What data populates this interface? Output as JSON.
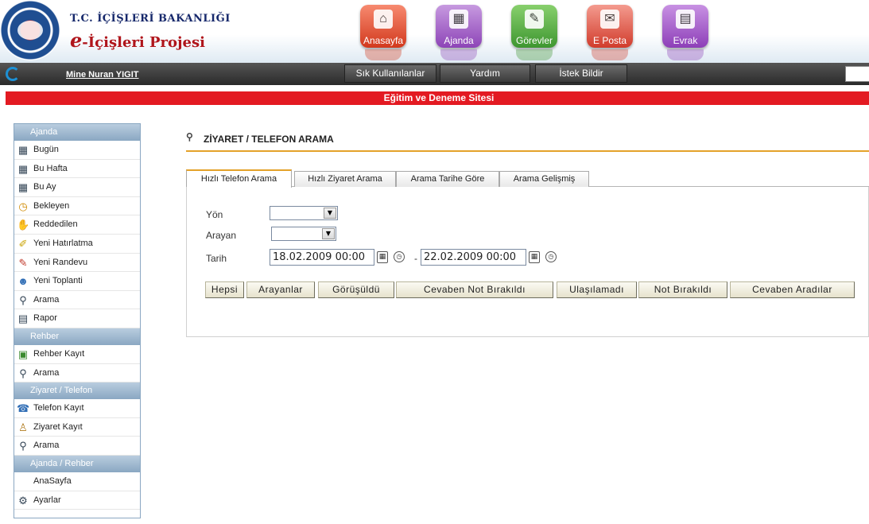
{
  "header": {
    "ministry": "T.C. İÇİŞLERİ BAKANLIĞI",
    "project_e": "e",
    "project_rest": "-İçişleri Projesi",
    "tiles": [
      {
        "label": "Anasayfa",
        "icon": "home-icon"
      },
      {
        "label": "Ajanda",
        "icon": "calendar-icon"
      },
      {
        "label": "Görevler",
        "icon": "tasks-icon"
      },
      {
        "label": "E Posta",
        "icon": "mail-icon"
      },
      {
        "label": "Evrak",
        "icon": "document-icon"
      }
    ]
  },
  "topbar": {
    "user": "Mine Nuran YIGIT",
    "buttons": [
      "Sık Kullanılanlar",
      "Yardım",
      "İstek Bildir"
    ]
  },
  "banner": "Eğitim ve Deneme Sitesi",
  "sidebar": {
    "sections": [
      {
        "title": "Ajanda",
        "items": [
          "Bugün",
          "Bu Hafta",
          "Bu Ay",
          "Bekleyen",
          "Reddedilen",
          "Yeni Hatırlatma",
          "Yeni Randevu",
          "Yeni Toplanti",
          "Arama",
          "Rapor"
        ]
      },
      {
        "title": "Rehber",
        "items": [
          "Rehber Kayıt",
          "Arama"
        ]
      },
      {
        "title": "Ziyaret / Telefon",
        "items": [
          "Telefon Kayıt",
          "Ziyaret Kayıt",
          "Arama"
        ]
      },
      {
        "title": "Ajanda / Rehber",
        "items": [
          "AnaSayfa",
          "Ayarlar"
        ]
      }
    ]
  },
  "main": {
    "title": "ZİYARET / TELEFON ARAMA",
    "tabs": [
      "Hızlı Telefon Arama",
      "Hızlı Ziyaret Arama",
      "Arama Tarihe Göre",
      "Arama Gelişmiş"
    ],
    "form": {
      "yon_label": "Yön",
      "arayan_label": "Arayan",
      "tarih_label": "Tarih",
      "date_from": "18.02.2009 00:00",
      "date_to": "22.02.2009 00:00",
      "dash": "-"
    },
    "filter_buttons": [
      "Hepsi",
      "Arayanlar",
      "Görüşüldü",
      "Cevaben Not Bırakıldı",
      "Ulaşılamadı",
      "Not Bırakıldı",
      "Cevaben Aradılar"
    ]
  },
  "colors": {
    "accent": "#e4a22a",
    "banner": "#e31a22",
    "brand_red": "#b0151b",
    "brand_blue": "#16286b"
  }
}
